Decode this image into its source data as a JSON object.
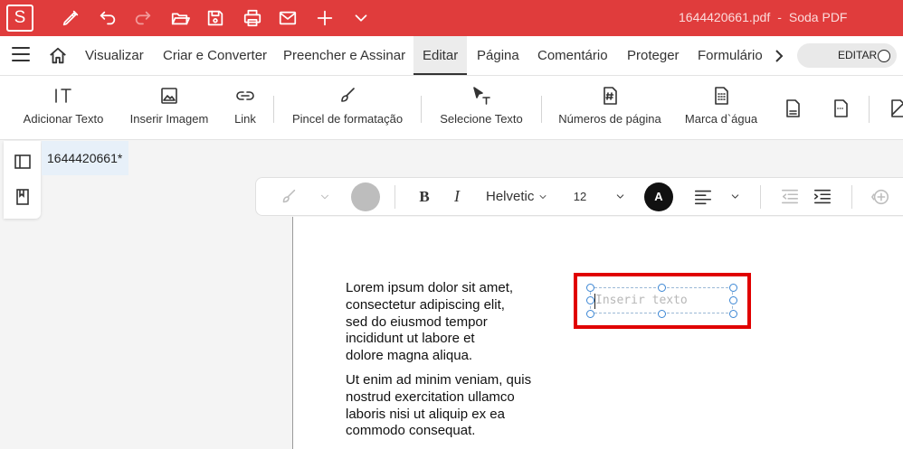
{
  "app": {
    "logo_letter": "S",
    "filename": "1644420661.pdf",
    "separator": "-",
    "app_name": "Soda PDF",
    "accent_color": "#e03c3c"
  },
  "titlebar_icons": [
    "pen-icon",
    "undo-icon",
    "redo-icon",
    "open-folder-icon",
    "save-icon",
    "print-icon",
    "mail-icon",
    "plus-icon",
    "chevron-down-icon"
  ],
  "menu": {
    "items": [
      "Visualizar",
      "Criar e Converter",
      "Preencher e Assinar",
      "Editar",
      "Página",
      "Comentário",
      "Proteger",
      "Formulário"
    ],
    "active": "Editar",
    "toggle_label": "EDITAR"
  },
  "ribbon": {
    "buttons": [
      {
        "label": "Adicionar Texto",
        "icon": "add-text-icon"
      },
      {
        "label": "Inserir Imagem",
        "icon": "image-icon"
      },
      {
        "label": "Link",
        "icon": "link-icon"
      },
      {
        "label": "Pincel de formatação",
        "icon": "format-brush-icon"
      },
      {
        "label": "Selecione Texto",
        "icon": "select-text-icon"
      },
      {
        "label": "Números de página",
        "icon": "page-number-icon"
      },
      {
        "label": "Marca d`água",
        "icon": "watermark-icon"
      }
    ],
    "extra_icons": [
      "header-footer-icon",
      "bates-icon",
      "edit-page-icon"
    ]
  },
  "document_tab": {
    "title": "1644420661*"
  },
  "format_toolbar": {
    "font": "Helvetic",
    "size": "12",
    "text_color_letter": "A",
    "bold": "B",
    "italic": "I"
  },
  "page": {
    "paragraph1": [
      "Lorem ipsum dolor sit amet,",
      "consectetur adipiscing elit,",
      "sed do eiusmod tempor",
      "incididunt ut labore et",
      "dolore magna aliqua."
    ],
    "paragraph2": [
      "Ut enim ad minim veniam, quis",
      "nostrud exercitation ullamco",
      "laboris nisi ut aliquip ex ea",
      "commodo consequat."
    ],
    "textbox_placeholder": "Inserir texto",
    "highlight_color": "#e00000"
  }
}
